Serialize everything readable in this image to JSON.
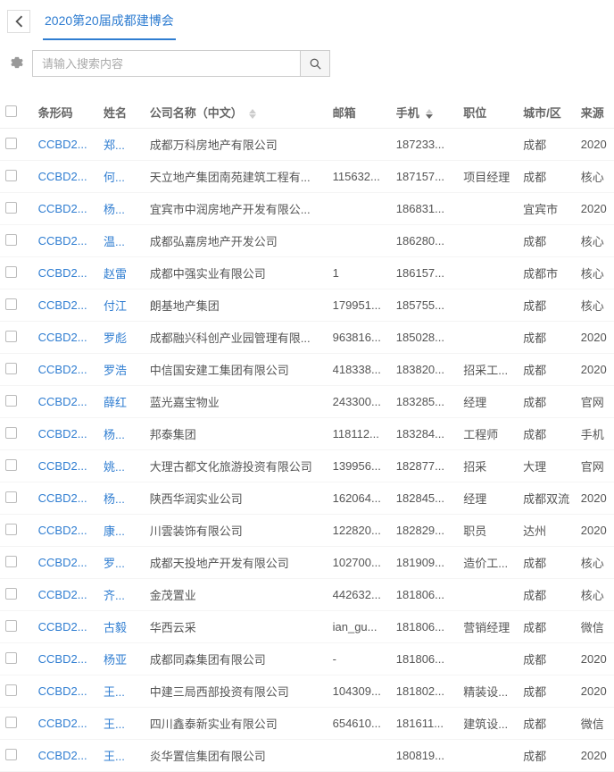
{
  "header": {
    "tab_title": "2020第20届成都建博会"
  },
  "search": {
    "placeholder": "请输入搜索内容"
  },
  "columns": {
    "barcode": "条形码",
    "name": "姓名",
    "company": "公司名称（中文）",
    "email": "邮箱",
    "phone": "手机",
    "position": "职位",
    "city": "城市/区",
    "source": "来源"
  },
  "rows": [
    {
      "barcode": "CCBD2...",
      "name": "郑...",
      "company": "成都万科房地产有限公司",
      "email": "",
      "phone": "187233...",
      "position": "",
      "city": "成都",
      "source": "2020"
    },
    {
      "barcode": "CCBD2...",
      "name": "何...",
      "company": "天立地产集团南苑建筑工程有...",
      "email": "115632...",
      "phone": "187157...",
      "position": "项目经理",
      "city": "成都",
      "source": "核心"
    },
    {
      "barcode": "CCBD2...",
      "name": "杨...",
      "company": "宜宾市中润房地产开发有限公...",
      "email": "",
      "phone": "186831...",
      "position": "",
      "city": "宜宾市",
      "source": "2020"
    },
    {
      "barcode": "CCBD2...",
      "name": "温...",
      "company": "成都弘嘉房地产开发公司",
      "email": "",
      "phone": "186280...",
      "position": "",
      "city": "成都",
      "source": "核心"
    },
    {
      "barcode": "CCBD2...",
      "name": "赵雷",
      "company": "成都中强实业有限公司",
      "email": "1",
      "phone": "186157...",
      "position": "",
      "city": "成都市",
      "source": "核心"
    },
    {
      "barcode": "CCBD2...",
      "name": "付江",
      "company": "朗基地产集团",
      "email": "179951...",
      "phone": "185755...",
      "position": "",
      "city": "成都",
      "source": "核心"
    },
    {
      "barcode": "CCBD2...",
      "name": "罗彪",
      "company": "成都融兴科创产业园管理有限...",
      "email": "963816...",
      "phone": "185028...",
      "position": "",
      "city": "成都",
      "source": "2020"
    },
    {
      "barcode": "CCBD2...",
      "name": "罗浩",
      "company": "中信国安建工集团有限公司",
      "email": "418338...",
      "phone": "183820...",
      "position": "招采工...",
      "city": "成都",
      "source": "2020"
    },
    {
      "barcode": "CCBD2...",
      "name": "薛红",
      "company": "蓝光嘉宝物业",
      "email": "243300...",
      "phone": "183285...",
      "position": "经理",
      "city": "成都",
      "source": "官网"
    },
    {
      "barcode": "CCBD2...",
      "name": "杨...",
      "company": "邦泰集团",
      "email": "118112...",
      "phone": "183284...",
      "position": "工程师",
      "city": "成都",
      "source": "手机"
    },
    {
      "barcode": "CCBD2...",
      "name": "姚...",
      "company": "大理古都文化旅游投资有限公司",
      "email": "139956...",
      "phone": "182877...",
      "position": "招采",
      "city": "大理",
      "source": "官网"
    },
    {
      "barcode": "CCBD2...",
      "name": "杨...",
      "company": "陕西华润实业公司",
      "email": "162064...",
      "phone": "182845...",
      "position": "经理",
      "city": "成都双流",
      "source": "2020"
    },
    {
      "barcode": "CCBD2...",
      "name": "康...",
      "company": "川雲装饰有限公司",
      "email": "122820...",
      "phone": "182829...",
      "position": "职员",
      "city": "达州",
      "source": "2020"
    },
    {
      "barcode": "CCBD2...",
      "name": "罗...",
      "company": "成都天投地产开发有限公司",
      "email": "102700...",
      "phone": "181909...",
      "position": "造价工...",
      "city": "成都",
      "source": "核心"
    },
    {
      "barcode": "CCBD2...",
      "name": "齐...",
      "company": "金茂置业",
      "email": "442632...",
      "phone": "181806...",
      "position": "",
      "city": "成都",
      "source": "核心"
    },
    {
      "barcode": "CCBD2...",
      "name": "古毅",
      "company": "华西云采",
      "email": "ian_gu...",
      "phone": "181806...",
      "position": "营销经理",
      "city": "成都",
      "source": "微信"
    },
    {
      "barcode": "CCBD2...",
      "name": "杨亚",
      "company": "成都同森集团有限公司",
      "email": "-",
      "phone": "181806...",
      "position": "",
      "city": "成都",
      "source": "2020"
    },
    {
      "barcode": "CCBD2...",
      "name": "王...",
      "company": "中建三局西部投资有限公司",
      "email": "104309...",
      "phone": "181802...",
      "position": "精装设...",
      "city": "成都",
      "source": "2020"
    },
    {
      "barcode": "CCBD2...",
      "name": "王...",
      "company": "四川鑫泰新实业有限公司",
      "email": "654610...",
      "phone": "181611...",
      "position": "建筑设...",
      "city": "成都",
      "source": "微信"
    },
    {
      "barcode": "CCBD2...",
      "name": "王...",
      "company": "炎华置信集团有限公司",
      "email": "",
      "phone": "180819...",
      "position": "",
      "city": "成都",
      "source": "2020"
    }
  ]
}
